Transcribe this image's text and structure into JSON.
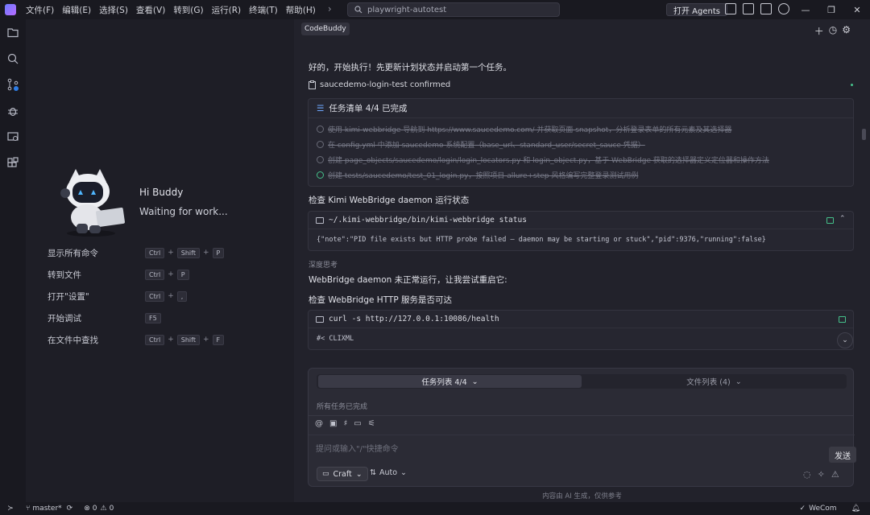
{
  "menu": [
    "文件(F)",
    "编辑(E)",
    "选择(S)",
    "查看(V)",
    "转到(G)",
    "运行(R)",
    "终端(T)",
    "帮助(H)"
  ],
  "search": {
    "text": "playwright-autotest"
  },
  "agents_button": "打开 Agents",
  "welcome": {
    "greeting": "Hi Buddy",
    "status": "Waiting for work...",
    "shortcuts": [
      {
        "label": "显示所有命令",
        "keys": [
          "Ctrl",
          "Shift",
          "P"
        ]
      },
      {
        "label": "转到文件",
        "keys": [
          "Ctrl",
          "P"
        ]
      },
      {
        "label": "打开\"设置\"",
        "keys": [
          "Ctrl",
          ","
        ]
      },
      {
        "label": "开始调试",
        "keys": [
          "F5"
        ]
      },
      {
        "label": "在文件中查找",
        "keys": [
          "Ctrl",
          "Shift",
          "F"
        ]
      }
    ]
  },
  "chat": {
    "tab": "CodeBuddy",
    "intro": "好的，开始执行！先更新计划状态并启动第一个任务。",
    "confirmed": "saucedemo-login-test confirmed",
    "task_header": "任务清单 4/4 已完成",
    "tasks": [
      "使用 kimi-webbridge 导航到 https://www.saucedemo.com/ 并获取页面 snapshot，分析登录表单的所有元素及其选择器",
      "在 config.yml 中添加 saucedemo 系统配置（base_url、standard_user/secret_sauce 凭据）",
      "创建 page_objects/saucedemo/login/login_locators.py 和 login_object.py，基于 WebBridge 获取的选择器定义定位器和操作方法",
      "创建 tests/saucedemo/test_01_login.py，按照项目 allure+step 风格编写完整登录测试用例"
    ],
    "check_daemon": "检查 Kimi WebBridge daemon 运行状态",
    "cmd1": "~/.kimi-webbridge/bin/kimi-webbridge status",
    "cmd1_out": "{\"note\":\"PID file exists but HTTP probe failed — daemon may be starting or stuck\",\"pid\":9376,\"running\":false}",
    "thinking": "深度思考",
    "daemon_msg": "WebBridge daemon 未正常运行，让我尝试重启它:",
    "check_http": "检查 WebBridge HTTP 服务是否可达",
    "cmd2": "curl -s http://127.0.0.1:10086/health",
    "cmd2_out": "#< CLIXML",
    "tab_tasks": "任务列表 4/4",
    "tab_files": "文件列表 (4)",
    "all_done": "所有任务已完成",
    "placeholder": "提问或输入\"/\"快捷命令",
    "mode": "Craft",
    "auto": "Auto",
    "send": "发送",
    "disclaimer": "内容由 AI 生成，仅供参考"
  },
  "status": {
    "branch": "master*",
    "errors": "0",
    "warnings": "0",
    "wecom": "WeCom"
  }
}
